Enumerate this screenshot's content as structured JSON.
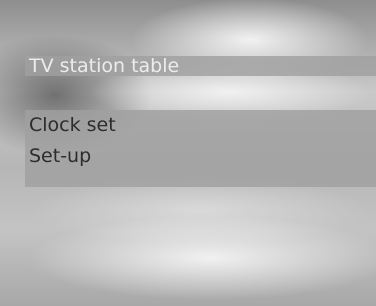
{
  "menu": {
    "items": [
      {
        "label": "TV station table",
        "selected": true
      },
      {
        "label": "Clock set",
        "selected": false
      },
      {
        "label": "Set-up",
        "selected": false
      }
    ]
  }
}
